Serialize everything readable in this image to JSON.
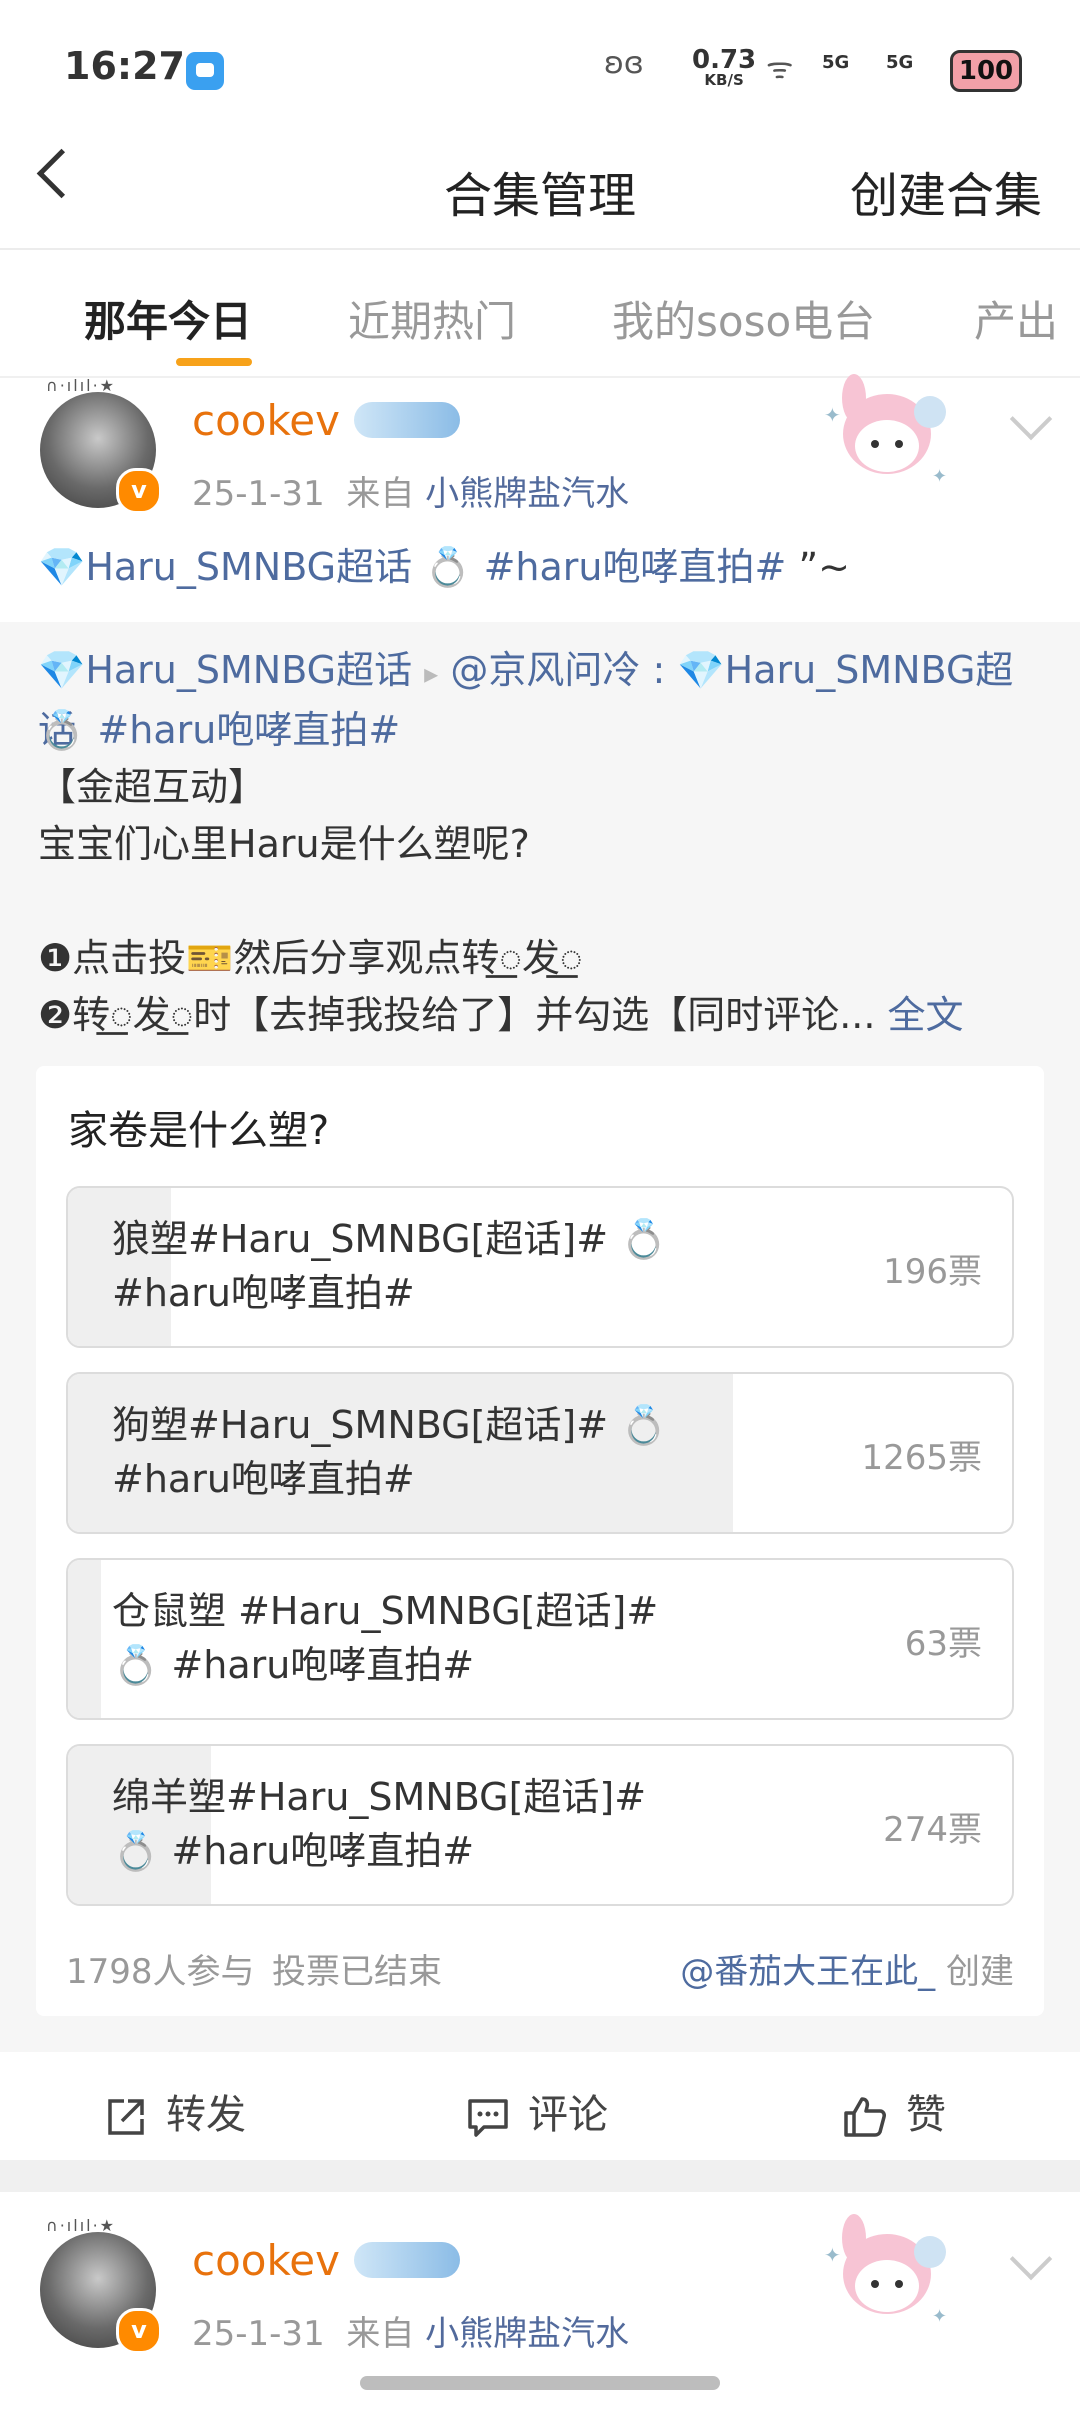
{
  "status": {
    "time": "16:27",
    "net_speed": "0.73",
    "net_unit": "KB/S",
    "signal1": "5G",
    "signal2": "5G",
    "battery": "100"
  },
  "header": {
    "title": "合集管理",
    "create_label": "创建合集"
  },
  "tabs": [
    {
      "label": "那年今日",
      "active": true
    },
    {
      "label": "近期热门",
      "active": false
    },
    {
      "label": "我的soso电台",
      "active": false
    },
    {
      "label": "产出",
      "active": false
    }
  ],
  "posts": [
    {
      "username": "cookev",
      "date": "25-1-31",
      "from_label": "来自",
      "source": "小熊牌盐汽水"
    },
    {
      "username": "cookev",
      "date": "25-1-31",
      "from_label": "来自",
      "source": "小熊牌盐汽水"
    }
  ],
  "post": {
    "topic1": "💎Haru_SMNBG超话",
    "ring": "💍",
    "topic2": "#haru咆哮直拍#",
    "tail": "”~"
  },
  "repost": {
    "topic1": "💎Haru_SMNBG超话",
    "arrow": "▸",
    "author": "@京风问冷",
    "colon": ":",
    "topic1b": "💎Haru_SMNBG超话",
    "ring": "💍",
    "topic2": "#haru咆哮直拍#",
    "line_bracket": "【金超互动】",
    "line_question": "宝宝们心里Haru是什么塑呢?",
    "line_step1": "❶点击投🎫然后分享观点转꯭发꯭",
    "line_step2": "❷转꯭发꯭时【去掉我投给了】并勾选【同时评论...",
    "full_text_label": "全文"
  },
  "vote": {
    "question": "家卷是什么塑?",
    "options": [
      {
        "line1": "狼塑#Haru_SMNBG[超话]# 💍",
        "line2": "#haru咆哮直拍#",
        "count": "196票",
        "fraction": 0.109
      },
      {
        "line1": "狗塑#Haru_SMNBG[超话]# 💍",
        "line2": "#haru咆哮直拍#",
        "count": "1265票",
        "fraction": 0.704
      },
      {
        "line1": "仓鼠塑 #Haru_SMNBG[超话]#",
        "line2": "💍 #haru咆哮直拍#",
        "count": "63票",
        "fraction": 0.035
      },
      {
        "line1": "绵羊塑#Haru_SMNBG[超话]#",
        "line2": "💍 #haru咆哮直拍#",
        "count": "274票",
        "fraction": 0.152
      }
    ],
    "participants": "1798人参与",
    "status": "投票已结束",
    "creator": "@番茄大王在此_",
    "creator_suffix": "创建"
  },
  "actions": {
    "repost": "转发",
    "comment": "评论",
    "like": "赞"
  },
  "colors": {
    "accent": "#f7a21a",
    "username": "#e8720c",
    "link": "#4e6b9f"
  }
}
